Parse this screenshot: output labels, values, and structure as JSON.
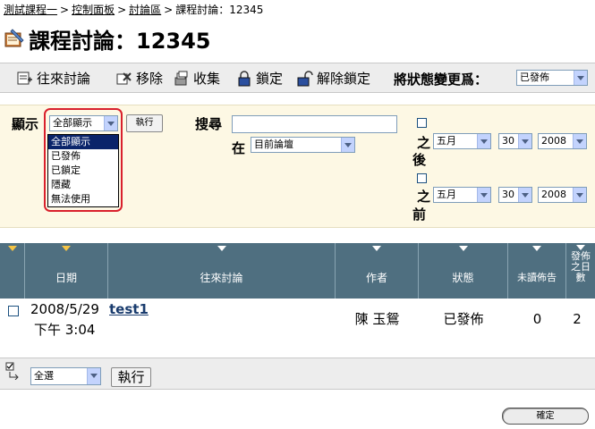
{
  "breadcrumb": {
    "items": [
      "測試課程一",
      "控制面板",
      "討論區",
      "課程討論：12345"
    ],
    "separator": ">"
  },
  "page_title": "課程討論：12345",
  "toolbar": {
    "items": [
      "往來討論",
      "移除",
      "收集",
      "鎖定",
      "解除鎖定"
    ],
    "change_state_label": "將狀態變更爲：",
    "change_state_value": "已發佈"
  },
  "filter": {
    "show_label": "顯示",
    "show_value": "全部顯示",
    "show_options": [
      "全部顯示",
      "已發佈",
      "已鎖定",
      "隱藏",
      "無法使用"
    ],
    "go_label": "執行",
    "search_label": "搜尋",
    "search_value": "",
    "in_label": "在",
    "in_value": "目前論壇",
    "after_label_1": "之",
    "after_label_2": "後",
    "before_label_1": "之",
    "before_label_2": "前",
    "after_month": "五月",
    "after_day": "30",
    "after_year": "2008",
    "before_month": "五月",
    "before_day": "30",
    "before_year": "2008"
  },
  "table": {
    "headers": [
      "日期",
      "往來討論",
      "作者",
      "狀態",
      "未讀佈告",
      "發佈之日數"
    ],
    "rows": [
      {
        "date_line1": "2008/5/29",
        "date_line2": "下午 3:04",
        "thread": "test1",
        "author": "陳 玉鴛",
        "status": "已發佈",
        "unread": "0",
        "total": "2"
      }
    ]
  },
  "bottom": {
    "select_value": "全選",
    "go_label": "執行"
  },
  "ok_label": "確定",
  "colors": {
    "header_bg": "#4f6f80",
    "filter_bg": "#fdf8e4",
    "toolbar_bg": "#ededed",
    "highlight": "#0a246a",
    "ring": "#d9202c",
    "sort_arrow_active": "#f5c445"
  }
}
